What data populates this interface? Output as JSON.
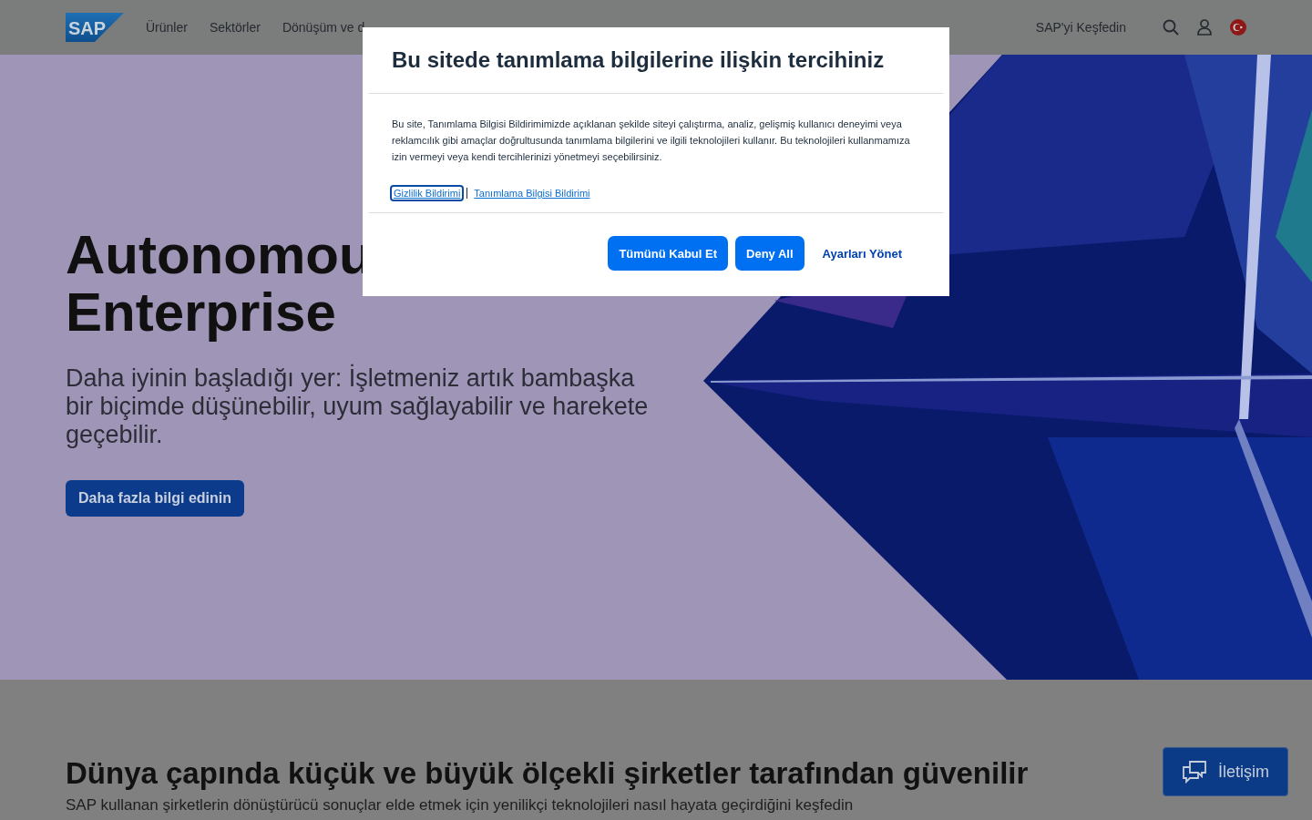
{
  "header": {
    "logo": "SAP",
    "nav": [
      "Ürünler",
      "Sektörler",
      "Dönüşüm ve d"
    ],
    "explore": "SAP'yi Keşfedin"
  },
  "hero": {
    "title_lines": [
      "Autonomou",
      "Enterprise"
    ],
    "subtitle": "Daha iyinin başladığı yer: İşletmeniz artık bambaşka bir biçimde düşünebilir, uyum sağlayabilir ve harekete geçebilir.",
    "button": "Daha fazla bilgi edinin",
    "image": {
      "kind": "picture"
    }
  },
  "trust": {
    "heading": "Dünya çapında küçük ve büyük ölçekli şirketler tarafından güvenilir",
    "text": "SAP kullanan şirketlerin dönüştürücü sonuçlar elde etmek için yenilikçi teknolojileri nasıl hayata geçirdiğini keşfedin"
  },
  "contact_button": "İletişim",
  "cookie_dialog": {
    "title": "Bu sitede tanımlama bilgilerine ilişkin tercihiniz",
    "body": "Bu site, Tanımlama Bilgisi Bildirimimizde açıklanan şekilde siteyi çalıştırma, analiz, gelişmiş kullanıcı deneyimi veya reklamcılık gibi amaçlar doğrultusunda tanımlama bilgilerini ve ilgili teknolojileri kullanır. Bu teknolojileri kullanmamıza izin vermeyi veya kendi tercihlerinizi yönetmeyi seçebilirsiniz.",
    "links": [
      {
        "label": "Gizlilik Bildirimi",
        "focused": true
      },
      {
        "label": "Tanımlama Bilgisi Bildirimi",
        "focused": false
      }
    ],
    "buttons": [
      {
        "label": "Tümünü Kabul Et",
        "kind": "primary"
      },
      {
        "label": "Deny All",
        "kind": "primary"
      },
      {
        "label": "Ayarları Yönet",
        "kind": "text"
      }
    ]
  }
}
